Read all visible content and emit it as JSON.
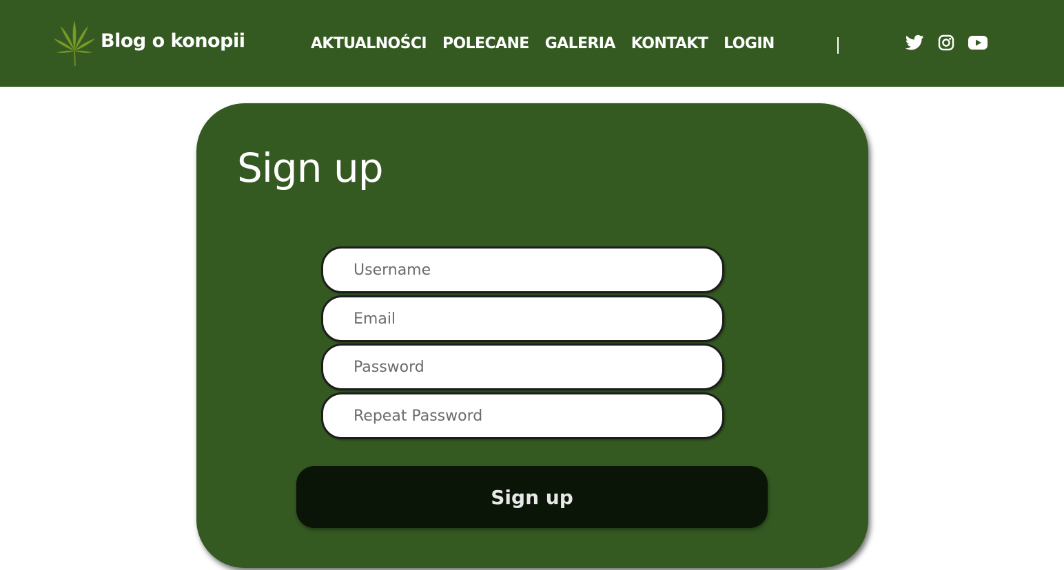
{
  "header": {
    "brand": {
      "title": "Blog o konopii",
      "logo_icon": "cannabis-leaf-icon"
    },
    "nav": [
      {
        "label": "AKTUALNOŚCI"
      },
      {
        "label": "POLECANE"
      },
      {
        "label": "GALERIA"
      },
      {
        "label": "KONTAKT"
      },
      {
        "label": "LOGIN"
      }
    ],
    "divider": "|",
    "socials": [
      {
        "icon": "twitter-icon"
      },
      {
        "icon": "instagram-icon"
      },
      {
        "icon": "youtube-icon"
      }
    ]
  },
  "form": {
    "title": "Sign up",
    "fields": {
      "username": {
        "placeholder": "Username",
        "value": ""
      },
      "email": {
        "placeholder": "Email",
        "value": ""
      },
      "password": {
        "placeholder": "Password",
        "value": ""
      },
      "repeat_password": {
        "placeholder": "Repeat Password",
        "value": ""
      }
    },
    "submit_label": "Sign up"
  },
  "colors": {
    "primary_green": "#345a22",
    "button_dark": "#0b1507",
    "text_light": "#ffffff"
  }
}
